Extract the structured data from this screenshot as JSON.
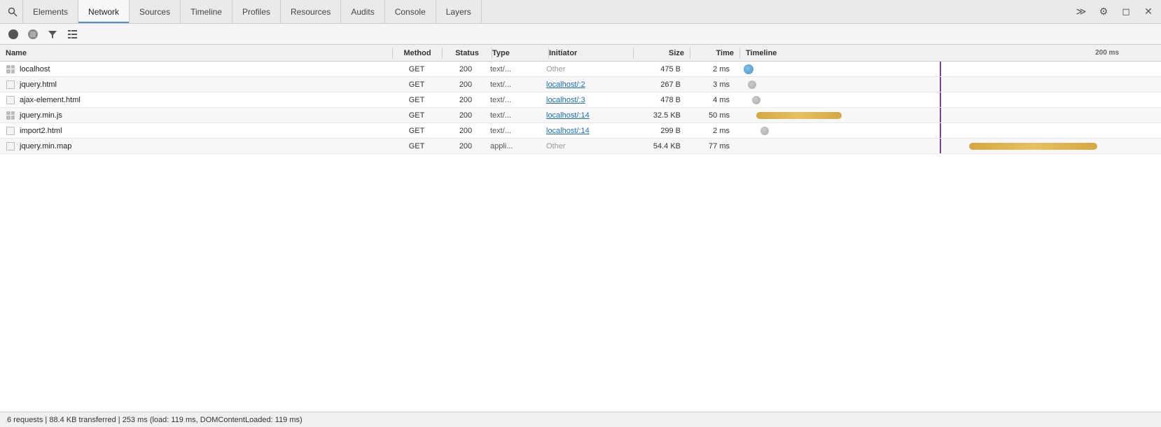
{
  "tabs": [
    {
      "id": "elements",
      "label": "Elements",
      "active": false
    },
    {
      "id": "network",
      "label": "Network",
      "active": true
    },
    {
      "id": "sources",
      "label": "Sources",
      "active": false
    },
    {
      "id": "timeline",
      "label": "Timeline",
      "active": false
    },
    {
      "id": "profiles",
      "label": "Profiles",
      "active": false
    },
    {
      "id": "resources",
      "label": "Resources",
      "active": false
    },
    {
      "id": "audits",
      "label": "Audits",
      "active": false
    },
    {
      "id": "console",
      "label": "Console",
      "active": false
    },
    {
      "id": "layers",
      "label": "Layers",
      "active": false
    }
  ],
  "toolbar": {
    "execute_label": "≫",
    "settings_label": "⚙",
    "undock_label": "◻",
    "close_label": "✕"
  },
  "table": {
    "headers": {
      "name": "Name",
      "method": "Method",
      "status": "Status",
      "type": "Type",
      "initiator": "Initiator",
      "size": "Size",
      "time": "Time",
      "timeline": "Timeline"
    },
    "timeline_label": "200 ms",
    "rows": [
      {
        "name": "localhost",
        "icon": "grid",
        "method": "GET",
        "status": "200",
        "type": "text/...",
        "initiator": "Other",
        "initiator_link": false,
        "size": "475 B",
        "time": "2 ms",
        "bar_type": "blue",
        "bar_left_pct": 2,
        "bar_width_pct": 3
      },
      {
        "name": "jquery.html",
        "icon": "blank",
        "method": "GET",
        "status": "200",
        "type": "text/...",
        "initiator": "localhost/:2",
        "initiator_link": true,
        "size": "267 B",
        "time": "3 ms",
        "bar_type": "gray",
        "bar_left_pct": 3,
        "bar_width_pct": 2
      },
      {
        "name": "ajax-element.html",
        "icon": "blank",
        "method": "GET",
        "status": "200",
        "type": "text/...",
        "initiator": "localhost/:3",
        "initiator_link": true,
        "size": "478 B",
        "time": "4 ms",
        "bar_type": "gray",
        "bar_left_pct": 4,
        "bar_width_pct": 2
      },
      {
        "name": "jquery.min.js",
        "icon": "grid",
        "method": "GET",
        "status": "200",
        "type": "text/...",
        "initiator": "localhost/:14",
        "initiator_link": true,
        "size": "32.5 KB",
        "time": "50 ms",
        "bar_type": "yellow",
        "bar_left_pct": 5,
        "bar_width_pct": 20
      },
      {
        "name": "import2.html",
        "icon": "blank",
        "method": "GET",
        "status": "200",
        "type": "text/...",
        "initiator": "localhost/:14",
        "initiator_link": true,
        "size": "299 B",
        "time": "2 ms",
        "bar_type": "gray",
        "bar_left_pct": 6,
        "bar_width_pct": 2
      },
      {
        "name": "jquery.min.map",
        "icon": "blank",
        "method": "GET",
        "status": "200",
        "type": "appli...",
        "initiator": "Other",
        "initiator_link": false,
        "size": "54.4 KB",
        "time": "77 ms",
        "bar_type": "yellow-right",
        "bar_left_pct": 55,
        "bar_width_pct": 30
      }
    ]
  },
  "status_bar": {
    "text": "6 requests | 88.4 KB transferred | 253 ms (load: 119 ms, DOMContentLoaded: 119 ms)"
  }
}
